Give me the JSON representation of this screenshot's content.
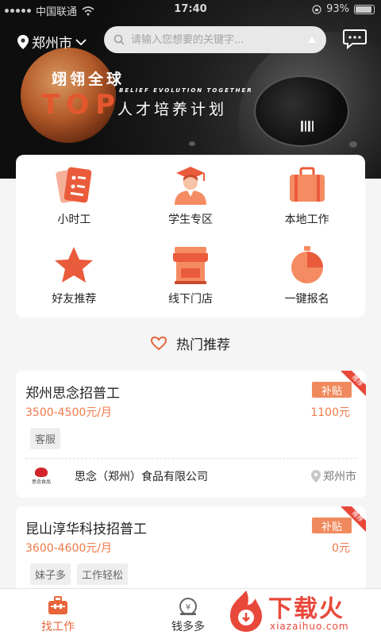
{
  "status_bar": {
    "carrier": "中国联通",
    "time": "17:40",
    "battery": "93%"
  },
  "header": {
    "city": "郑州市",
    "search_placeholder": "请输入您想要的关键字..."
  },
  "banner": {
    "line1": "翊翎全球",
    "top_word": "TOP",
    "english": "BELIEF EVOLUTION TOGETHER",
    "line2": "人才培养计划"
  },
  "categories": [
    {
      "label": "小时工",
      "icon": "part-time-icon"
    },
    {
      "label": "学生专区",
      "icon": "student-icon"
    },
    {
      "label": "本地工作",
      "icon": "briefcase-icon"
    },
    {
      "label": "好友推荐",
      "icon": "star-icon"
    },
    {
      "label": "线下门店",
      "icon": "store-icon"
    },
    {
      "label": "一键报名",
      "icon": "stopwatch-icon"
    }
  ],
  "section": {
    "hot_title": "热门推荐"
  },
  "jobs": [
    {
      "title": "郑州思念招普工",
      "salary": "3500-4500元/月",
      "subsidy_label": "补贴",
      "subsidy_amount": "1100元",
      "corner": "推荐",
      "tags": [
        "客服"
      ],
      "company_logo_text": "思念食品",
      "company": "思念（郑州）食品有限公司",
      "location": "郑州市"
    },
    {
      "title": "昆山淳华科技招普工",
      "salary": "3600-4600元/月",
      "subsidy_label": "补贴",
      "subsidy_amount": "0元",
      "corner": "推荐",
      "tags": [
        "妹子多",
        "工作轻松"
      ]
    }
  ],
  "tabbar": {
    "find_job": "找工作",
    "money": "钱多多"
  },
  "watermark": {
    "text": "下载火",
    "url": "xiazaihuo.com"
  },
  "colors": {
    "accent": "#f07a4a",
    "icon_orange": "#f58b62",
    "icon_red": "#ea5b3b"
  }
}
